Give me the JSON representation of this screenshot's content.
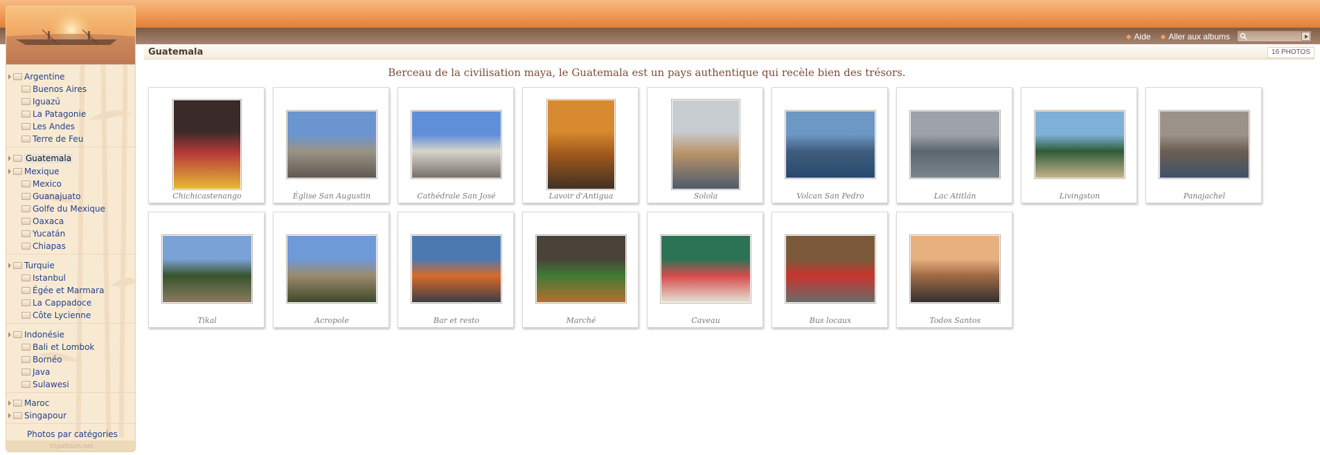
{
  "header": {
    "links": [
      {
        "label": "Aide",
        "icon": "bullet-icon"
      },
      {
        "label": "Aller aux albums",
        "icon": "bullet-icon"
      }
    ],
    "search": {
      "placeholder": "",
      "icon": "search-icon",
      "go_icon": "arrow-right-icon"
    }
  },
  "sidebar": {
    "groups": [
      {
        "label": "Argentine",
        "children": [
          "Buenos Aires",
          "Iguazú",
          "La Patagonie",
          "Les Andes",
          "Terre de Feu"
        ]
      },
      {
        "label": "Guatemala",
        "active": true,
        "children": []
      },
      {
        "label": "Mexique",
        "children": [
          "Mexico",
          "Guanajuato",
          "Golfe du Mexique",
          "Oaxaca",
          "Yucatán",
          "Chiapas"
        ]
      },
      {
        "label": "Turquie",
        "children": [
          "Istanbul",
          "Égée et Marmara",
          "La Cappadoce",
          "Côte Lycienne"
        ]
      },
      {
        "label": "Indonésie",
        "children": [
          "Bali et Lombok",
          "Bornéo",
          "Java",
          "Sulawesi"
        ]
      },
      {
        "label": "Maroc",
        "children": []
      },
      {
        "label": "Singapour",
        "children": []
      }
    ],
    "photos_by_category": "Photos par catégories",
    "footer": "tripalbum.net"
  },
  "album": {
    "title": "Guatemala",
    "photo_count": "16 PHOTOS",
    "description": "Berceau de la civilisation maya, le Guatemala est un pays authentique qui recèle bien des trésors."
  },
  "photos": [
    {
      "caption": "Chichicastenango",
      "orientation": "portrait",
      "colors": [
        "#3b2a2a",
        "#b83a3a",
        "#e7b935"
      ]
    },
    {
      "caption": "Église San Augustin",
      "orientation": "landscape",
      "colors": [
        "#6a95cf",
        "#9a9385",
        "#5f5a52"
      ]
    },
    {
      "caption": "Cathédrale San José",
      "orientation": "landscape",
      "colors": [
        "#5f8fd8",
        "#d8d4cc",
        "#76706a"
      ]
    },
    {
      "caption": "Lavoir d'Antigua",
      "orientation": "portrait",
      "colors": [
        "#d78a2f",
        "#a35a1c",
        "#403024"
      ]
    },
    {
      "caption": "Solola",
      "orientation": "portrait",
      "colors": [
        "#c7ccd0",
        "#b89367",
        "#4d5b6c"
      ]
    },
    {
      "caption": "Volcan San Pedro",
      "orientation": "landscape",
      "colors": [
        "#6d97c4",
        "#3f5e7e",
        "#28496e"
      ]
    },
    {
      "caption": "Lac Atitlán",
      "orientation": "landscape",
      "colors": [
        "#9da3a8",
        "#5b6670",
        "#7b858c"
      ]
    },
    {
      "caption": "Livingston",
      "orientation": "landscape",
      "colors": [
        "#7fb0d8",
        "#2d5c38",
        "#c4b38a"
      ]
    },
    {
      "caption": "Panajachel",
      "orientation": "landscape",
      "colors": [
        "#9b9389",
        "#6c5e52",
        "#3f5069"
      ]
    },
    {
      "caption": "Tikal",
      "orientation": "landscape",
      "colors": [
        "#7ba2d6",
        "#37542c",
        "#8a7a5f"
      ]
    },
    {
      "caption": "Acropole",
      "orientation": "landscape",
      "colors": [
        "#6f9ad8",
        "#9c8a6c",
        "#3f4a2d"
      ]
    },
    {
      "caption": "Bar et resto",
      "orientation": "landscape",
      "colors": [
        "#4c7ab0",
        "#d86a2a",
        "#3d3d46"
      ]
    },
    {
      "caption": "Marché",
      "orientation": "landscape",
      "colors": [
        "#4a4238",
        "#3f7b35",
        "#b86e2d"
      ]
    },
    {
      "caption": "Caveau",
      "orientation": "landscape",
      "colors": [
        "#2c7356",
        "#d74b4b",
        "#e4e0d2"
      ]
    },
    {
      "caption": "Bus locaux",
      "orientation": "landscape",
      "colors": [
        "#7a5a3a",
        "#c7352f",
        "#6a6a6a"
      ]
    },
    {
      "caption": "Todos Santos",
      "orientation": "landscape",
      "colors": [
        "#e7b07f",
        "#9f6a44",
        "#33312f"
      ]
    }
  ]
}
